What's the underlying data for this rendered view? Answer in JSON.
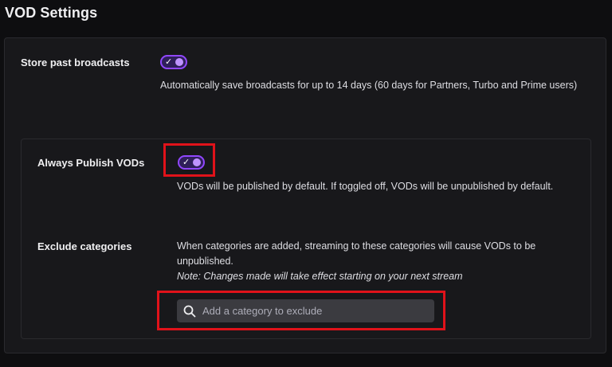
{
  "page": {
    "title": "VOD Settings"
  },
  "store_past": {
    "label": "Store past broadcasts",
    "enabled": true,
    "description": "Automatically save broadcasts for up to 14 days (60 days for Partners, Turbo and Prime users)"
  },
  "always_publish": {
    "label": "Always Publish VODs",
    "enabled": true,
    "description": "VODs will be published by default. If toggled off, VODs will be unpublished by default."
  },
  "exclude_categories": {
    "label": "Exclude categories",
    "description": "When categories are added, streaming to these categories will cause VODs to be unpublished.",
    "note": "Note: Changes made will take effect starting on your next stream",
    "search_placeholder": "Add a category to exclude",
    "search_value": ""
  },
  "icons": {
    "toggle_check": "check-icon",
    "search": "search-icon"
  },
  "colors": {
    "accent": "#9147ff",
    "knob": "#bf94ff",
    "highlight": "#e0121a",
    "background": "#0e0e10",
    "card": "#18181b"
  }
}
